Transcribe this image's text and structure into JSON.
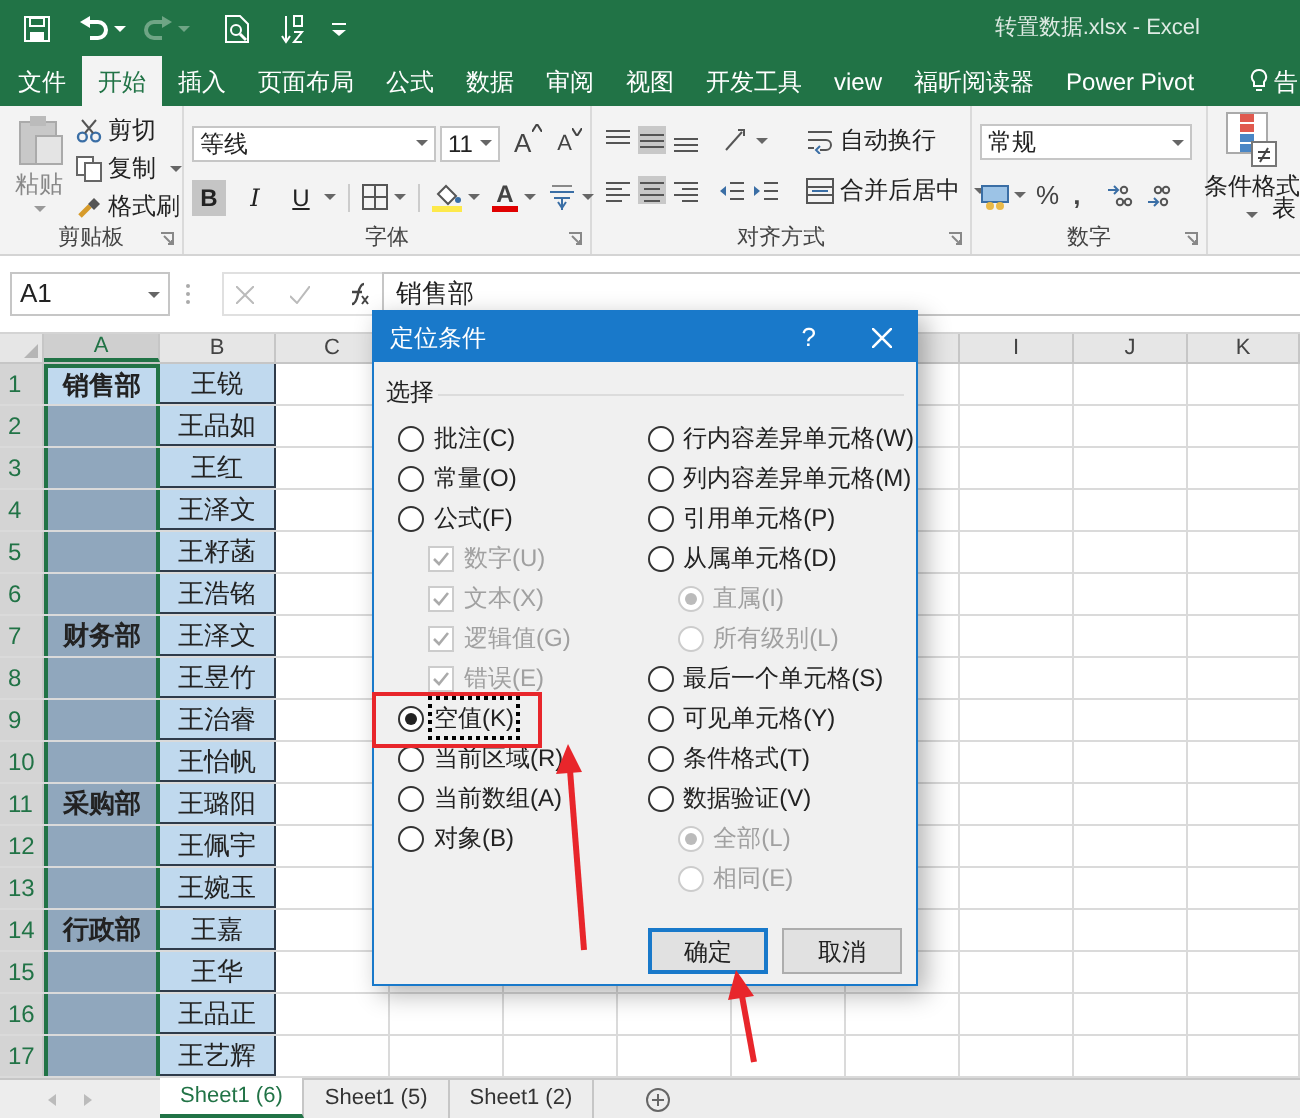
{
  "window": {
    "title": "转置数据.xlsx  -  Excel"
  },
  "ribbon_tabs": [
    {
      "label": "文件",
      "selected": false
    },
    {
      "label": "开始",
      "selected": true
    },
    {
      "label": "插入",
      "selected": false
    },
    {
      "label": "页面布局",
      "selected": false
    },
    {
      "label": "公式",
      "selected": false
    },
    {
      "label": "数据",
      "selected": false
    },
    {
      "label": "审阅",
      "selected": false
    },
    {
      "label": "视图",
      "selected": false
    },
    {
      "label": "开发工具",
      "selected": false
    },
    {
      "label": "view",
      "selected": false
    },
    {
      "label": "福昕阅读器",
      "selected": false
    },
    {
      "label": "Power Pivot",
      "selected": false
    },
    {
      "label": "告",
      "selected": false
    }
  ],
  "clipboard": {
    "paste": "粘贴",
    "cut": "剪切",
    "copy": "复制",
    "format_painter": "格式刷",
    "group_label": "剪贴板"
  },
  "font": {
    "font_name": "等线",
    "font_size": "11",
    "grow": "A",
    "shrink": "A",
    "font_color": "A",
    "group_label": "字体",
    "style_buttons": [
      {
        "label": "B",
        "on": true
      },
      {
        "label": "I",
        "on": false
      },
      {
        "label": "U",
        "on": false
      }
    ]
  },
  "alignment": {
    "wrap_text": "自动换行",
    "merge_center": "合并后居中",
    "group_label": "对齐方式"
  },
  "number": {
    "format": "常规",
    "percent": "%",
    "comma": ",",
    "group_label": "数字"
  },
  "styles": {
    "conditional_format": "条件格式",
    "table_format": "表"
  },
  "formula_bar": {
    "name_box": "A1",
    "value": "销售部"
  },
  "columns": [
    {
      "label": "A",
      "selected": true
    },
    {
      "label": "B",
      "selected": false
    },
    {
      "label": "C",
      "selected": false
    },
    {
      "label": "I",
      "selected": false
    },
    {
      "label": "J",
      "selected": false
    },
    {
      "label": "K",
      "selected": false
    }
  ],
  "rows": [
    {
      "number": "1",
      "active": true,
      "cells": [
        "销售部",
        "王锐"
      ]
    },
    {
      "number": "2",
      "active": false,
      "cells": [
        "",
        "王品如"
      ]
    },
    {
      "number": "3",
      "active": false,
      "cells": [
        "",
        "王红"
      ]
    },
    {
      "number": "4",
      "active": false,
      "cells": [
        "",
        "王泽文"
      ]
    },
    {
      "number": "5",
      "active": false,
      "cells": [
        "",
        "王籽菡"
      ]
    },
    {
      "number": "6",
      "active": false,
      "cells": [
        "",
        "王浩铭"
      ]
    },
    {
      "number": "7",
      "active": false,
      "cells": [
        "财务部",
        "王泽文"
      ]
    },
    {
      "number": "8",
      "active": false,
      "cells": [
        "",
        "王昱竹"
      ]
    },
    {
      "number": "9",
      "active": false,
      "cells": [
        "",
        "王治睿"
      ]
    },
    {
      "number": "10",
      "active": false,
      "cells": [
        "",
        "王怡帆"
      ]
    },
    {
      "number": "11",
      "active": false,
      "cells": [
        "采购部",
        "王璐阳"
      ]
    },
    {
      "number": "12",
      "active": false,
      "cells": [
        "",
        "王佩宇"
      ]
    },
    {
      "number": "13",
      "active": false,
      "cells": [
        "",
        "王婉玉"
      ]
    },
    {
      "number": "14",
      "active": false,
      "cells": [
        "行政部",
        "王嘉"
      ]
    },
    {
      "number": "15",
      "active": false,
      "cells": [
        "",
        "王华"
      ]
    },
    {
      "number": "16",
      "active": false,
      "cells": [
        "",
        "王品正"
      ]
    },
    {
      "number": "17",
      "active": false,
      "cells": [
        "",
        "王艺辉"
      ]
    }
  ],
  "dialog": {
    "title": "定位条件",
    "help": "?",
    "section": "选择",
    "left_options": [
      {
        "kind": "radio",
        "label": "批注(C)",
        "selected": false,
        "focused": false,
        "disabled": false
      },
      {
        "kind": "radio",
        "label": "常量(O)",
        "selected": false,
        "focused": false,
        "disabled": false
      },
      {
        "kind": "radio",
        "label": "公式(F)",
        "selected": false,
        "focused": false,
        "disabled": false,
        "children": [
          {
            "kind": "checkbox",
            "label": "数字(U)",
            "checked": true,
            "disabled": true
          },
          {
            "kind": "checkbox",
            "label": "文本(X)",
            "checked": true,
            "disabled": true
          },
          {
            "kind": "checkbox",
            "label": "逻辑值(G)",
            "checked": true,
            "disabled": true
          },
          {
            "kind": "checkbox",
            "label": "错误(E)",
            "checked": true,
            "disabled": true
          }
        ]
      },
      {
        "kind": "radio",
        "label": "空值(K)",
        "selected": true,
        "focused": true,
        "disabled": false
      },
      {
        "kind": "radio",
        "label": "当前区域(R)",
        "selected": false,
        "focused": false,
        "disabled": false
      },
      {
        "kind": "radio",
        "label": "当前数组(A)",
        "selected": false,
        "focused": false,
        "disabled": false
      },
      {
        "kind": "radio",
        "label": "对象(B)",
        "selected": false,
        "focused": false,
        "disabled": false
      }
    ],
    "right_options": [
      {
        "kind": "radio",
        "label": "行内容差异单元格(W)",
        "selected": false,
        "focused": false,
        "disabled": false
      },
      {
        "kind": "radio",
        "label": "列内容差异单元格(M)",
        "selected": false,
        "focused": false,
        "disabled": false
      },
      {
        "kind": "radio",
        "label": "引用单元格(P)",
        "selected": false,
        "focused": false,
        "disabled": false
      },
      {
        "kind": "radio",
        "label": "从属单元格(D)",
        "selected": false,
        "focused": false,
        "disabled": false,
        "children": [
          {
            "kind": "radio",
            "label": "直属(I)",
            "selected": true,
            "disabled": true
          },
          {
            "kind": "radio",
            "label": "所有级别(L)",
            "selected": false,
            "disabled": true
          }
        ]
      },
      {
        "kind": "radio",
        "label": "最后一个单元格(S)",
        "selected": false,
        "focused": false,
        "disabled": false
      },
      {
        "kind": "radio",
        "label": "可见单元格(Y)",
        "selected": false,
        "focused": false,
        "disabled": false
      },
      {
        "kind": "radio",
        "label": "条件格式(T)",
        "selected": false,
        "focused": false,
        "disabled": false
      },
      {
        "kind": "radio",
        "label": "数据验证(V)",
        "selected": false,
        "focused": false,
        "disabled": false,
        "children": [
          {
            "kind": "radio",
            "label": "全部(L)",
            "selected": true,
            "disabled": true
          },
          {
            "kind": "radio",
            "label": "相同(E)",
            "selected": false,
            "disabled": true
          }
        ]
      }
    ],
    "buttons": [
      {
        "label": "确定",
        "default": true
      },
      {
        "label": "取消",
        "default": false
      }
    ]
  },
  "sheet_tabs": [
    {
      "label": "Sheet1 (6)",
      "selected": true
    },
    {
      "label": "Sheet1 (5)",
      "selected": false
    },
    {
      "label": "Sheet1 (2)",
      "selected": false
    }
  ]
}
